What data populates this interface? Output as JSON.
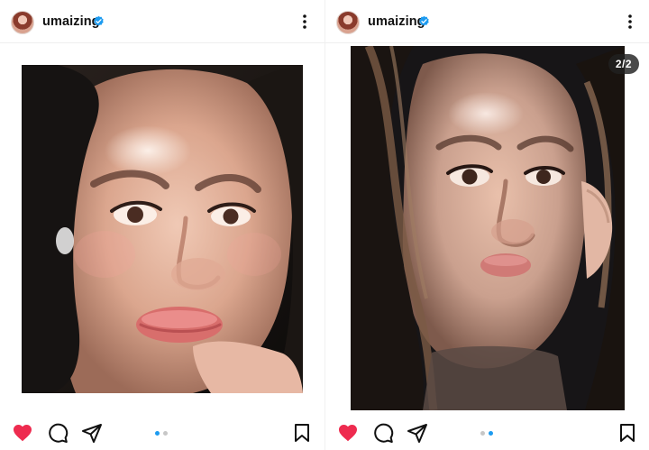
{
  "posts": [
    {
      "username": "umaizing",
      "verified": true,
      "avatar_icon": "profile-avatar",
      "more_icon": "more-vertical-icon",
      "photo_alt": "",
      "carousel": {
        "current": 1,
        "total": 2,
        "counter_text": ""
      },
      "actions": {
        "heart_icon": "heart-filled-icon",
        "comment_icon": "comment-icon",
        "share_icon": "paper-plane-icon",
        "save_icon": "bookmark-icon"
      },
      "accent": "#1d9bf0",
      "heart_color": "#ee2b4f"
    },
    {
      "username": "umaizing",
      "verified": true,
      "avatar_icon": "profile-avatar",
      "more_icon": "more-vertical-icon",
      "photo_alt": "",
      "carousel": {
        "current": 2,
        "total": 2,
        "counter_text": "2/2"
      },
      "actions": {
        "heart_icon": "heart-filled-icon",
        "comment_icon": "comment-icon",
        "share_icon": "paper-plane-icon",
        "save_icon": "bookmark-icon"
      },
      "accent": "#1d9bf0",
      "heart_color": "#ee2b4f"
    }
  ]
}
